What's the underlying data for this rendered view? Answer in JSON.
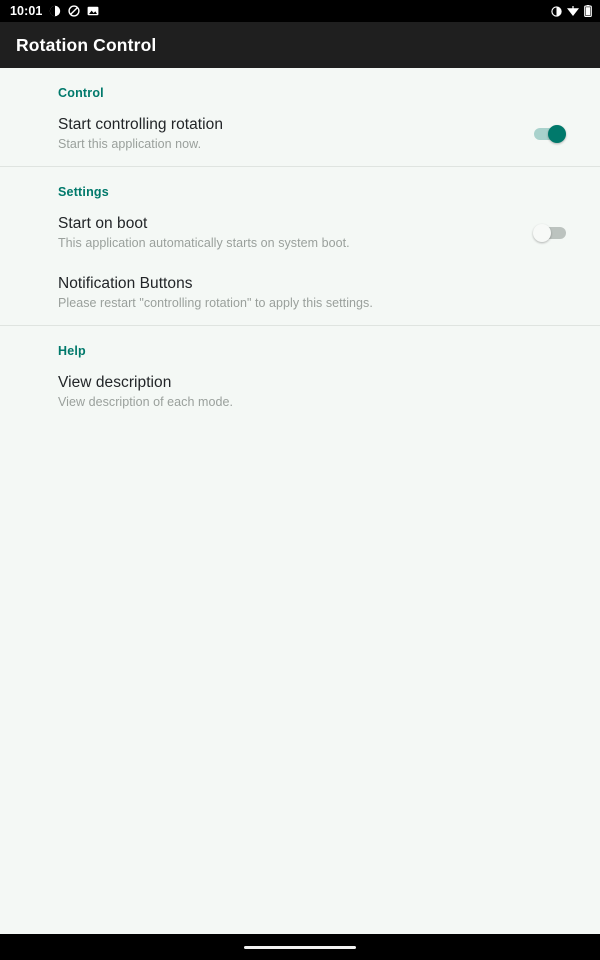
{
  "status_bar": {
    "clock": "10:01",
    "left_icons": [
      {
        "name": "contrast-icon"
      },
      {
        "name": "silent-mode-icon"
      },
      {
        "name": "image-icon"
      }
    ],
    "right_icons": [
      {
        "name": "contrast-icon"
      },
      {
        "name": "wifi-icon"
      },
      {
        "name": "battery-icon"
      }
    ]
  },
  "app_bar": {
    "title": "Rotation Control"
  },
  "colors": {
    "accent": "#00796b",
    "app_bar_bg": "#1f1f1f",
    "page_bg": "#f4f8f5",
    "title_text": "#222528",
    "summary_text": "#9aa09c",
    "divider": "#dfe4e0",
    "switch_on_track": "#a9d2cc",
    "switch_off_track": "#bcc3bf",
    "switch_off_thumb": "#f7f9f7"
  },
  "sections": [
    {
      "header": "Control",
      "rows": [
        {
          "title": "Start controlling rotation",
          "summary": "Start this application now.",
          "widget": "switch",
          "switch_state": "on"
        }
      ]
    },
    {
      "header": "Settings",
      "rows": [
        {
          "title": "Start on boot",
          "summary": "This application automatically starts on system boot.",
          "widget": "switch",
          "switch_state": "off"
        },
        {
          "title": "Notification Buttons",
          "summary": "Please restart \"controlling rotation\" to apply this settings.",
          "widget": "none",
          "switch_state": ""
        }
      ]
    },
    {
      "header": "Help",
      "rows": [
        {
          "title": "View description",
          "summary": "View description of each mode.",
          "widget": "none",
          "switch_state": ""
        }
      ]
    }
  ]
}
